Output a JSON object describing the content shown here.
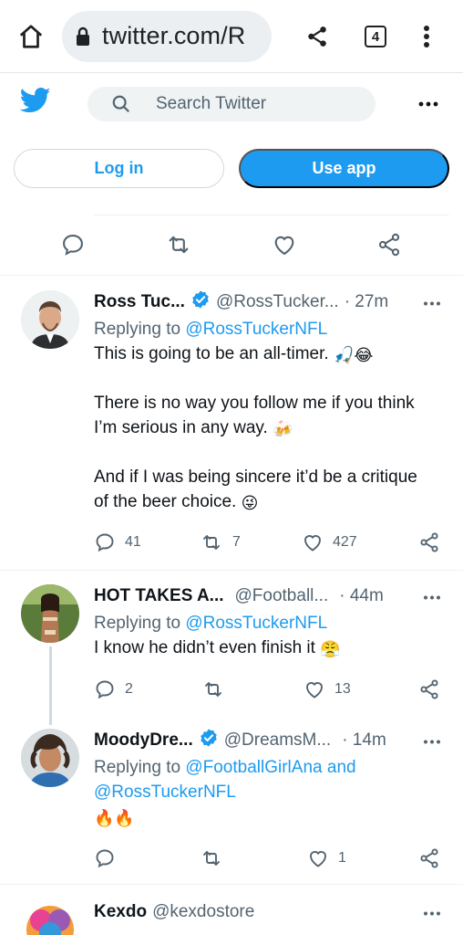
{
  "browser": {
    "url": "twitter.com/R",
    "tab_count": "4"
  },
  "header": {
    "search_placeholder": "Search Twitter"
  },
  "auth": {
    "login_label": "Log in",
    "use_app_label": "Use app"
  },
  "tweets": [
    {
      "name": "Ross Tuc...",
      "verified": true,
      "handle": "@RossTucker...",
      "time": "· 27m",
      "replying_prefix": "Replying to ",
      "replying_to": "@RossTuckerNFL",
      "p1": "This is going to be an all-timer.",
      "p1_emojis": "🎣😂",
      "p2a": "There is no way you follow me if you think",
      "p2b": "I’m serious in any way.",
      "p2_emoji": "🍻",
      "p3a": "And if I was being sincere it’d be a critique",
      "p3b": "of the beer choice.",
      "p3_emoji": "😜",
      "replies": "41",
      "retweets": "7",
      "likes": "427"
    },
    {
      "name": "HOT TAKES A...",
      "verified": false,
      "handle": "@Football...",
      "time": "· 44m",
      "replying_prefix": "Replying to ",
      "replying_to": "@RossTuckerNFL",
      "text": "I know he didn’t even finish it",
      "emoji": "😤",
      "replies": "2",
      "retweets": "",
      "likes": "13"
    },
    {
      "name": "MoodyDre...",
      "verified": true,
      "handle": "@DreamsM...",
      "time": "· 14m",
      "replying_prefix": "Replying to ",
      "replying_to_1": "@FootballGirlAna",
      "and": " and",
      "replying_to_2": "@RossTuckerNFL",
      "emoji": "🔥🔥",
      "replies": "",
      "retweets": "",
      "likes": "1"
    },
    {
      "name": "Kexdo",
      "handle": "@kexdostore"
    }
  ],
  "colors": {
    "brand": "#1d9bf0",
    "text": "#0f1419",
    "muted": "#536471"
  }
}
